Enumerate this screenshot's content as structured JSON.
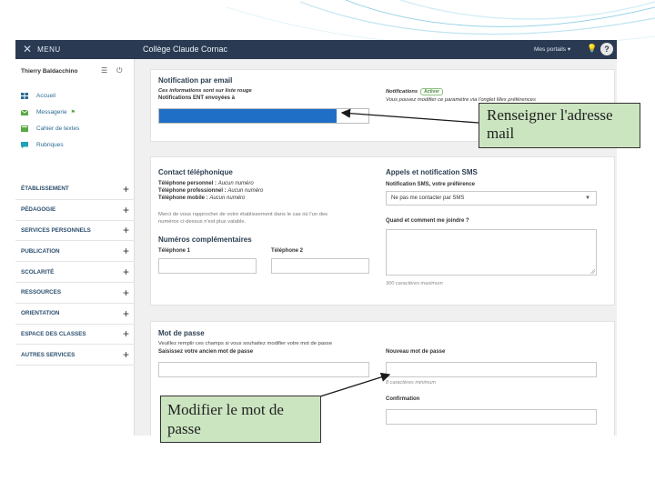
{
  "colors": {
    "topbar": "#2a3a52",
    "callout": "#cbe5c0",
    "highlight": "#1f6fc6",
    "link": "#2b6a93",
    "decoration": "#7ec8e3"
  },
  "topbar": {
    "menu_label": "MENU",
    "college_name": "Collège Claude Cornac",
    "portails_label": "Mes portails ▾",
    "bulb_icon": "lightbulb-icon",
    "help_label": "?"
  },
  "sidebar": {
    "user_name": "Thierry Baldacchino",
    "nav": [
      {
        "label": "Accueil",
        "icon": "grid-icon"
      },
      {
        "label": "Messagerie",
        "icon": "mail-icon",
        "flag": "⚑"
      },
      {
        "label": "Cahier de textes",
        "icon": "book-icon"
      },
      {
        "label": "Rubriques",
        "icon": "chat-icon"
      }
    ],
    "sections": [
      "ÉTABLISSEMENT",
      "PÉDAGOGIE",
      "SERVICES PERSONNELS",
      "PUBLICATION",
      "SCOLARITÉ",
      "RESSOURCES",
      "ORIENTATION",
      "ESPACE DES CLASSES",
      "AUTRES SERVICES"
    ],
    "section_action": "+"
  },
  "email_panel": {
    "title": "Notification par email",
    "note": "Ces informations sont sur liste rouge",
    "field_label": "Notifications ENT envoyées à",
    "notifications_label": "Notifications",
    "notifications_status": "Activer",
    "notifications_hint": "Vous pouvez modifier ce paramètre via l'onglet Mes préférences"
  },
  "phone_panel": {
    "title": "Contact téléphonique",
    "personal_label": "Téléphone personnel :",
    "personal_value": "Aucun numéro",
    "pro_label": "Téléphone professionnel :",
    "pro_value": "Aucun numéro",
    "mobile_label": "Téléphone mobile :",
    "mobile_value": "Aucun numéro",
    "note_line1": "Merci de vous rapprocher de votre établissement dans le cas où l'un des",
    "note_line2": "numéros ci-dessus n'est plus valable.",
    "extra_title": "Numéros complémentaires",
    "phone1_label": "Téléphone 1",
    "phone2_label": "Téléphone 2",
    "sms_title": "Appels et notification SMS",
    "sms_pref_label": "Notification SMS, votre préférence",
    "sms_pref_value": "Ne pas me contacter par SMS",
    "when_label": "Quand et comment me joindre ?",
    "max_chars": "300 caractères maximum"
  },
  "password_panel": {
    "title": "Mot de passe",
    "intro": "Veuillez remplir ces champs si vous souhaitez modifier votre mot de passe",
    "old_label": "Saisissez votre ancien mot de passe",
    "new_label": "Nouveau mot de passe",
    "min_chars": "8 caractères minimum",
    "confirm_label": "Confirmation"
  },
  "callouts": {
    "email": "Renseigner l'adresse mail",
    "password": "Modifier le mot de passe"
  }
}
